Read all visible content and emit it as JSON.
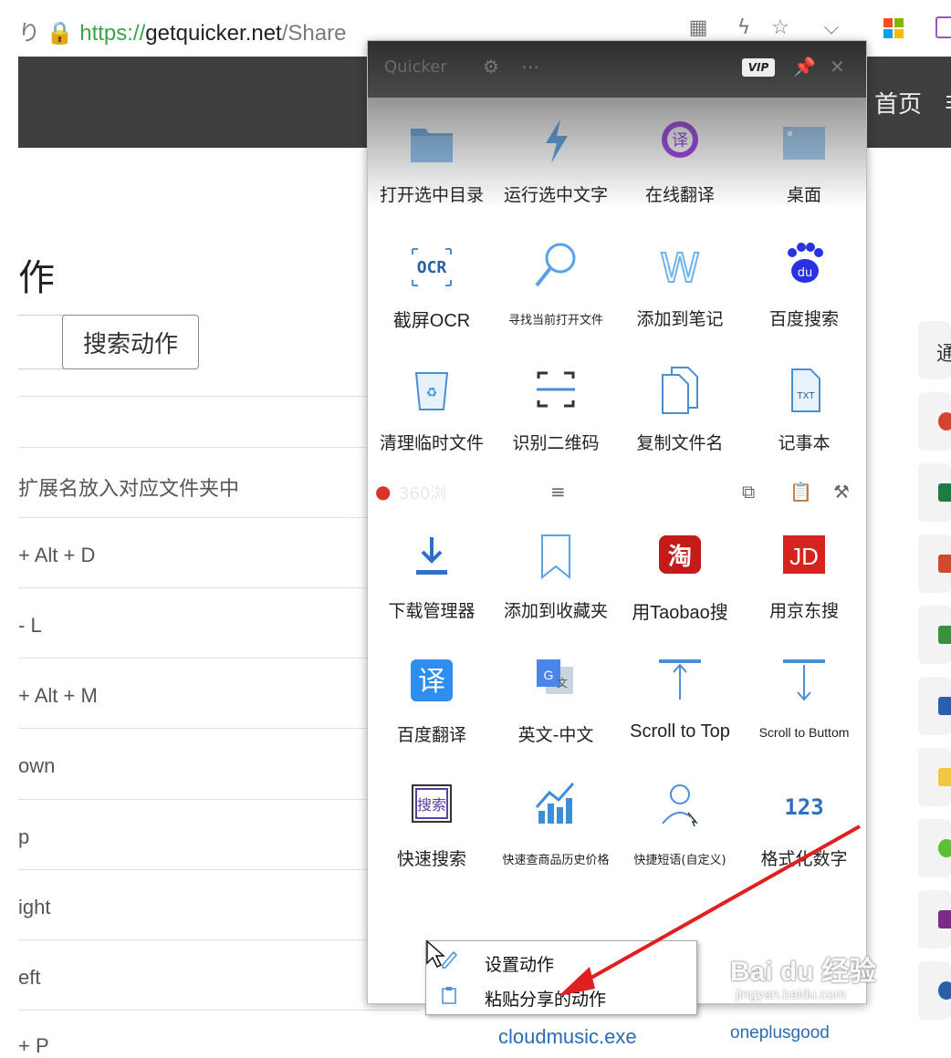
{
  "browser": {
    "url_prefix": "り",
    "url_scheme": "https://",
    "url_host": "getquicker.net",
    "url_path": "/Share"
  },
  "site": {
    "nav_home": "首页",
    "nav_more": "非"
  },
  "page": {
    "title": "作",
    "search_button": "搜索动作",
    "rows": [
      "扩展名放入对应文件夹中",
      "+ Alt + D",
      "- L",
      "+ Alt + M",
      "own",
      "p",
      "ight",
      "eft",
      "+ P"
    ]
  },
  "sidebar": {
    "header": "通"
  },
  "quicker": {
    "title": "Quicker",
    "vip": "VIP",
    "items": [
      {
        "label": "打开选中目录",
        "icon": "folder-icon"
      },
      {
        "label": "运行选中文字",
        "icon": "lightning-icon"
      },
      {
        "label": "在线翻译",
        "icon": "translate-bubble-icon"
      },
      {
        "label": "桌面",
        "icon": "desktop-icon"
      },
      {
        "label": "截屏OCR",
        "icon": "ocr-icon"
      },
      {
        "label": "寻找当前打开文件",
        "icon": "magnifier-icon"
      },
      {
        "label": "添加到笔记",
        "icon": "w-note-icon"
      },
      {
        "label": "百度搜索",
        "icon": "baidu-paw-icon"
      },
      {
        "label": "清理临时文件",
        "icon": "recycle-bin-icon"
      },
      {
        "label": "识别二维码",
        "icon": "qr-scan-icon"
      },
      {
        "label": "复制文件名",
        "icon": "copy-file-icon"
      },
      {
        "label": "记事本",
        "icon": "txt-file-icon"
      },
      {
        "label": "下载管理器",
        "icon": "download-icon"
      },
      {
        "label": "添加到收藏夹",
        "icon": "bookmark-icon"
      },
      {
        "label": "用Taobao搜",
        "icon": "taobao-icon"
      },
      {
        "label": "用京东搜",
        "icon": "jd-icon"
      },
      {
        "label": "百度翻译",
        "icon": "baidu-translate-icon"
      },
      {
        "label": "英文-中文",
        "icon": "google-translate-icon"
      },
      {
        "label": "Scroll to Top",
        "icon": "scroll-top-icon"
      },
      {
        "label": "Scroll to Buttom",
        "icon": "scroll-bottom-icon"
      },
      {
        "label": "快速搜索",
        "icon": "quick-search-icon"
      },
      {
        "label": "快速查商品历史价格",
        "icon": "price-chart-icon"
      },
      {
        "label": "快捷短语(自定义)",
        "icon": "user-phrase-icon"
      },
      {
        "label": "格式化数字",
        "icon": "number-format-icon"
      }
    ],
    "strip_app_label": "360浏"
  },
  "context_menu": {
    "items": [
      "设置动作",
      "粘贴分享的动作"
    ]
  },
  "background": {
    "item1": "cloudmusic.exe",
    "item2": "oneplusgood"
  },
  "watermark": {
    "main": "Bai du 经验",
    "sub": "jingyan.baidu.com"
  },
  "colors": {
    "header_dark": "#3e3e3e",
    "quicker_blue": "#3b8fd9",
    "arrow_red": "#e02020"
  }
}
